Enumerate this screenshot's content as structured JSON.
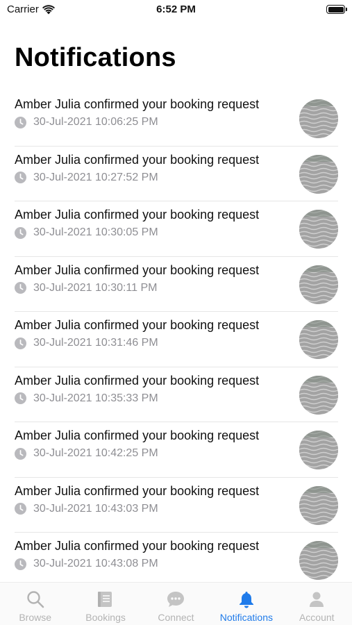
{
  "status_bar": {
    "carrier": "Carrier",
    "time": "6:52 PM"
  },
  "page": {
    "title": "Notifications"
  },
  "notifications": [
    {
      "text": "Amber Julia confirmed your booking request",
      "timestamp": "30-Jul-2021 10:06:25 PM"
    },
    {
      "text": "Amber Julia confirmed your booking request",
      "timestamp": "30-Jul-2021 10:27:52 PM"
    },
    {
      "text": "Amber Julia confirmed your booking request",
      "timestamp": "30-Jul-2021 10:30:05 PM"
    },
    {
      "text": "Amber Julia confirmed your booking request",
      "timestamp": "30-Jul-2021 10:30:11 PM"
    },
    {
      "text": "Amber Julia confirmed your booking request",
      "timestamp": "30-Jul-2021 10:31:46 PM"
    },
    {
      "text": "Amber Julia confirmed your booking request",
      "timestamp": "30-Jul-2021 10:35:33 PM"
    },
    {
      "text": "Amber Julia confirmed your booking request",
      "timestamp": "30-Jul-2021 10:42:25 PM"
    },
    {
      "text": "Amber Julia confirmed your booking request",
      "timestamp": "30-Jul-2021 10:43:03 PM"
    },
    {
      "text": "Amber Julia confirmed your booking request",
      "timestamp": "30-Jul-2021 10:43:08 PM"
    }
  ],
  "tab_bar": {
    "items": [
      {
        "label": "Browse",
        "icon": "search-icon",
        "active": false
      },
      {
        "label": "Bookings",
        "icon": "bookings-icon",
        "active": false
      },
      {
        "label": "Connect",
        "icon": "chat-bubble-icon",
        "active": false
      },
      {
        "label": "Notifications",
        "icon": "bell-icon",
        "active": true
      },
      {
        "label": "Account",
        "icon": "person-icon",
        "active": false
      }
    ]
  },
  "colors": {
    "accent": "#1f7bea",
    "inactive": "#b3b3b3",
    "secondary_text": "#8e8e93"
  }
}
